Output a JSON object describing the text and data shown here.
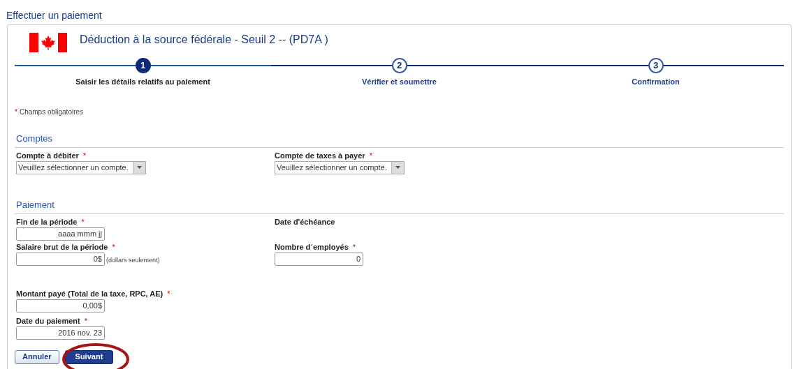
{
  "page_title": "Effectuer un paiement",
  "form_title": "Déduction à la source fédérale - Seuil 2 -- (PD7A )",
  "steps": [
    {
      "number": "1",
      "label": "Saisir les détails relatifs au paiement",
      "selected": true
    },
    {
      "number": "2",
      "label": "Vérifier et soumettre",
      "selected": false
    },
    {
      "number": "3",
      "label": "Confirmation",
      "selected": false
    }
  ],
  "required_note": {
    "marker": "*",
    "text": "Champs obligatoires"
  },
  "sections": [
    {
      "title": "Comptes",
      "rows": [
        [
          {
            "kind": "select",
            "label": "Compte à débiter",
            "required_mark": "*",
            "value": "Veuillez sélectionner un compte."
          },
          {
            "kind": "select",
            "label": "Compte de taxes à payer",
            "required_mark": "*",
            "value": "Veuillez sélectionner un compte."
          }
        ]
      ]
    },
    {
      "title": "Paiement",
      "rows": [
        [
          {
            "kind": "input",
            "label": "Fin de la période",
            "required_mark": "*",
            "value": "aaaa mmm jj"
          },
          {
            "kind": "label",
            "label": "Date d'échéance"
          }
        ],
        [
          {
            "kind": "input",
            "label": "Salaire brut de la période",
            "required_mark": "*",
            "value": "0$",
            "note": "(dollars seulement)"
          },
          {
            "kind": "input",
            "label": "Nombre d´employés",
            "required_mark": "*",
            "value": "0"
          }
        ]
      ]
    }
  ],
  "payment_fields": [
    {
      "kind": "input",
      "label": "Montant payé (Total de la taxe, RPC, AE)",
      "required_mark": "*",
      "value": "0,00$"
    },
    {
      "kind": "input",
      "label": "Date du paiement",
      "required_mark": "*",
      "value": "2016 nov. 23"
    }
  ],
  "buttons": [
    {
      "label": "Annuler",
      "kind": "secondary"
    },
    {
      "label": "Suivant",
      "kind": "primary"
    }
  ]
}
